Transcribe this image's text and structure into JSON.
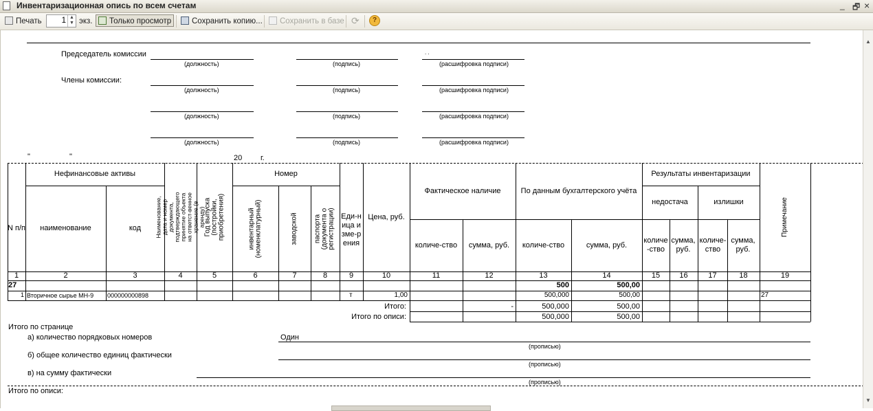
{
  "window": {
    "title": "Инвентаризационная опись по всем счетам",
    "restore_glyph": "🗗",
    "close_glyph": "×",
    "minimize_glyph": "_"
  },
  "toolbar": {
    "print_label": "Печать",
    "copies_value": "1",
    "copies_suffix": "экз.",
    "view_only_label": "Только просмотр",
    "save_copy_label": "Сохранить копию...",
    "save_db_label": "Сохранить в базе",
    "refresh_glyph": "⟳",
    "help_glyph": "?"
  },
  "commission": {
    "chairman_label": "Председатель комиссии",
    "members_label": "Члены комиссии:",
    "position_caption": "(должность)",
    "signature_caption": "(подпись)",
    "decoding_caption": "(расшифровка подписи)",
    "dots": ". .",
    "quote_open": "\"",
    "quote_close": "\"",
    "year_prefix": "20",
    "year_suffix": "г."
  },
  "table_header": {
    "row_num": "N п/п",
    "nonfin_assets": "Нефинансовые активы",
    "name": "наименование",
    "code": "код",
    "doc_info": "Наименование, дата и номер документа, подтверждающего принятие объекта на ответст-венное хранение (в аренду)",
    "year": "Год выпуска (постройки, приобретения)",
    "number": "Номер",
    "inventory": "инвентарный (номенклатурный)",
    "factory": "заводской",
    "passport": "паспорта (документа о регистрации)",
    "unit": "Еди-ница изме-рения",
    "price": "Цена, руб.",
    "actual": "Фактическое наличие",
    "accounting": "По данным бухгалтерского учёта",
    "qty": "количе-ство",
    "sum": "сумма, руб.",
    "results": "Результаты инвентаризации",
    "shortage": "недостача",
    "surplus": "излишки",
    "res_qty": "количе-ство",
    "res_sum": "сумма, руб.",
    "note": "Примечание",
    "col_numbers": [
      "1",
      "2",
      "3",
      "4",
      "5",
      "6",
      "7",
      "8",
      "9",
      "10",
      "11",
      "12",
      "13",
      "14",
      "15",
      "16",
      "17",
      "18",
      "19"
    ]
  },
  "group_row": {
    "label": "27",
    "acc_qty": "500",
    "acc_sum": "500,00"
  },
  "item_row": {
    "num": "1",
    "name": "Вторичное сырье МН-9",
    "code": "000000000898",
    "unit": "т",
    "price": "1,00",
    "acc_qty": "500,000",
    "acc_sum": "500,00",
    "note": "27"
  },
  "totals": {
    "total_label": "Итого:",
    "total_dash": "-",
    "total_qty": "500,000",
    "total_sum": "500,00",
    "inventory_total_label": "Итого по описи:",
    "inventory_qty": "500,000",
    "inventory_sum": "500,00"
  },
  "page_summary": {
    "title": "Итого по странице",
    "line_a": "а) количество порядковых номеров",
    "line_a_value": "Один",
    "line_b": "б) общее  количество единиц фактически",
    "line_c": "в) на сумму фактически",
    "in_words": "(прописью)",
    "inventory_total": "Итого по описи:"
  }
}
